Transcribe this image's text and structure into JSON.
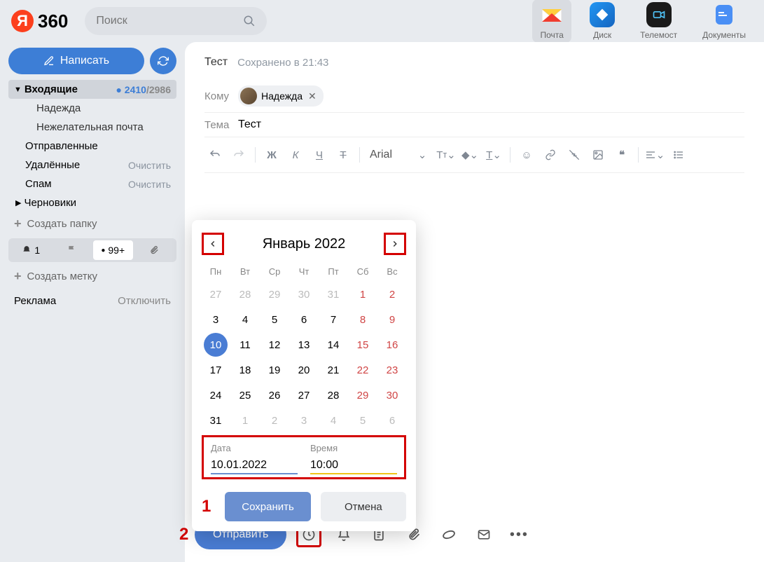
{
  "logo": {
    "letter": "Я",
    "text": "360"
  },
  "search": {
    "placeholder": "Поиск"
  },
  "apps": [
    {
      "name": "Почта",
      "active": true,
      "color": "#ffcf3e"
    },
    {
      "name": "Диск",
      "active": false,
      "color": "#2196f3"
    },
    {
      "name": "Телемост",
      "active": false,
      "color": "#1a1a1a"
    },
    {
      "name": "Документы",
      "active": false,
      "color": "#4a8ff5"
    }
  ],
  "compose": {
    "label": "Написать"
  },
  "folders": {
    "inbox": {
      "label": "Входящие",
      "unread": "2410",
      "total": "2986"
    },
    "sub1": "Надежда",
    "sub2": "Нежелательная почта",
    "sent": "Отправленные",
    "deleted": {
      "label": "Удалённые",
      "clear": "Очистить"
    },
    "spam": {
      "label": "Спам",
      "clear": "Очистить"
    },
    "drafts": "Черновики",
    "create_folder": "Создать папку",
    "create_label": "Создать метку"
  },
  "tags": {
    "bell": "1",
    "dot": "99+"
  },
  "ad": {
    "label": "Реклама",
    "disable": "Отключить"
  },
  "draft": {
    "title": "Тест",
    "saved": "Сохранено в 21:43"
  },
  "to": {
    "label": "Кому",
    "chip": "Надежда"
  },
  "subject": {
    "label": "Тема",
    "value": "Тест"
  },
  "toolbar": {
    "bold": "Ж",
    "italic": "К",
    "underline": "Ч",
    "strike": "Т",
    "font": "Arial"
  },
  "datepicker": {
    "title": "Январь 2022",
    "dow": [
      "Пн",
      "Вт",
      "Ср",
      "Чт",
      "Пт",
      "Сб",
      "Вс"
    ],
    "weeks": [
      [
        {
          "d": "27",
          "m": true
        },
        {
          "d": "28",
          "m": true
        },
        {
          "d": "29",
          "m": true
        },
        {
          "d": "30",
          "m": true
        },
        {
          "d": "31",
          "m": true
        },
        {
          "d": "1",
          "w": true
        },
        {
          "d": "2",
          "w": true
        }
      ],
      [
        {
          "d": "3"
        },
        {
          "d": "4"
        },
        {
          "d": "5"
        },
        {
          "d": "6"
        },
        {
          "d": "7"
        },
        {
          "d": "8",
          "w": true
        },
        {
          "d": "9",
          "w": true
        }
      ],
      [
        {
          "d": "10",
          "s": true
        },
        {
          "d": "11"
        },
        {
          "d": "12"
        },
        {
          "d": "13"
        },
        {
          "d": "14"
        },
        {
          "d": "15",
          "w": true
        },
        {
          "d": "16",
          "w": true
        }
      ],
      [
        {
          "d": "17"
        },
        {
          "d": "18"
        },
        {
          "d": "19"
        },
        {
          "d": "20"
        },
        {
          "d": "21"
        },
        {
          "d": "22",
          "w": true
        },
        {
          "d": "23",
          "w": true
        }
      ],
      [
        {
          "d": "24"
        },
        {
          "d": "25"
        },
        {
          "d": "26"
        },
        {
          "d": "27"
        },
        {
          "d": "28"
        },
        {
          "d": "29",
          "w": true
        },
        {
          "d": "30",
          "w": true
        }
      ],
      [
        {
          "d": "31"
        },
        {
          "d": "1",
          "m": true
        },
        {
          "d": "2",
          "m": true
        },
        {
          "d": "3",
          "m": true
        },
        {
          "d": "4",
          "m": true
        },
        {
          "d": "5",
          "m": true
        },
        {
          "d": "6",
          "m": true
        }
      ]
    ],
    "date_label": "Дата",
    "time_label": "Время",
    "date_value": "10.01.2022",
    "time_value": "10:00",
    "save": "Сохранить",
    "cancel": "Отмена",
    "marker1": "1"
  },
  "bottom": {
    "marker2": "2",
    "send": "Отправить"
  }
}
